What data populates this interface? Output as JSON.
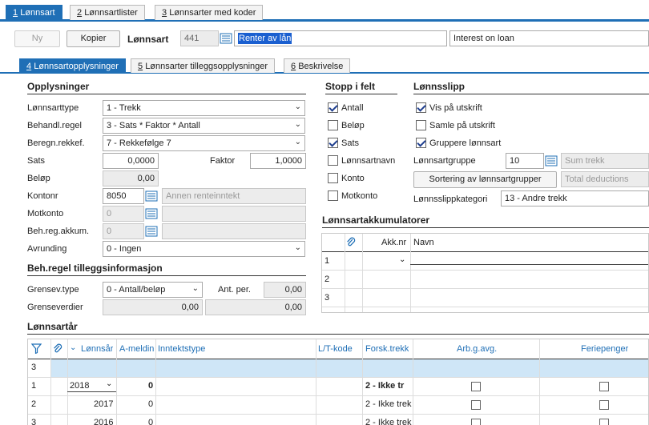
{
  "top_tabs": [
    {
      "key": "1",
      "label": "Lønnsart"
    },
    {
      "key": "2",
      "label": "Lønnsartlister"
    },
    {
      "key": "3",
      "label": "Lønnsarter med koder"
    }
  ],
  "header": {
    "new_button": "Ny",
    "copy_button": "Kopier",
    "lonnsart_label": "Lønnsart",
    "lonnsart_number": "441",
    "name_no": "Renter av lån",
    "name_en": "Interest on loan"
  },
  "sub_tabs": [
    {
      "key": "4",
      "label": "Lønnsartopplysninger"
    },
    {
      "key": "5",
      "label": "Lønnsarter tilleggsopplysninger"
    },
    {
      "key": "6",
      "label": "Beskrivelse"
    }
  ],
  "opplysninger": {
    "title": "Opplysninger",
    "lonnsarttype_label": "Lønnsarttype",
    "lonnsarttype_value": "1 - Trekk",
    "behandl_label": "Behandl.regel",
    "behandl_value": "3 - Sats * Faktor * Antall",
    "beregn_label": "Beregn.rekkef.",
    "beregn_value": "7 - Rekkefølge 7",
    "sats_label": "Sats",
    "sats_value": "0,0000",
    "faktor_label": "Faktor",
    "faktor_value": "1,0000",
    "belop_label": "Beløp",
    "belop_value": "0,00",
    "kontonr_label": "Kontonr",
    "kontonr_value": "8050",
    "kontonr_desc": "Annen renteinntekt",
    "motkonto_label": "Motkonto",
    "motkonto_value": "0",
    "behreg_label": "Beh.reg.akkum.",
    "behreg_value": "0",
    "avrunding_label": "Avrunding",
    "avrunding_value": "0 - Ingen"
  },
  "tillegg": {
    "title": "Beh.regel tilleggsinformasjon",
    "grensev_label": "Grensev.type",
    "grensev_value": "0 - Antall/beløp",
    "antper_label": "Ant. per.",
    "antper_value": "0,00",
    "grenseverdier_label": "Grenseverdier",
    "grenseverdier_1": "0,00",
    "grenseverdier_2": "0,00"
  },
  "stopp": {
    "title": "Stopp i felt",
    "items": [
      {
        "label": "Antall",
        "checked": true
      },
      {
        "label": "Beløp",
        "checked": false
      },
      {
        "label": "Sats",
        "checked": true
      },
      {
        "label": "Lønnsartnavn",
        "checked": false
      },
      {
        "label": "Konto",
        "checked": false
      },
      {
        "label": "Motkonto",
        "checked": false
      }
    ]
  },
  "lonnsslipp": {
    "title": "Lønnsslipp",
    "vis_label": "Vis på utskrift",
    "vis_checked": true,
    "samle_label": "Samle på utskrift",
    "samle_checked": false,
    "grupper_label": "Gruppere lønnsart",
    "grupper_checked": true,
    "gruppe_label": "Lønnsartgruppe",
    "gruppe_value": "10",
    "gruppe_desc": "Sum trekk",
    "sortering_button": "Sortering av lønnsartgrupper",
    "sortering_desc": "Total deductions",
    "kategori_label": "Lønnsslippkategori",
    "kategori_value": "13 - Andre trekk"
  },
  "akkumulatorer": {
    "title": "Lønnsartakkumulatorer",
    "col_akk": "Akk.nr",
    "col_navn": "Navn",
    "rows": [
      "1",
      "2",
      "3"
    ]
  },
  "lonnsartar": {
    "title": "Lønnsartår",
    "columns": [
      "Lønnsår",
      "A-meldin",
      "Inntektstype",
      "L/T-kode",
      "Forsk.trekk",
      "Arb.g.avg.",
      "Feriepenger"
    ],
    "filter_row": "3",
    "rows": [
      {
        "n": "1",
        "year": "2018",
        "ameld": "0",
        "forsk": "2 - Ikke tr"
      },
      {
        "n": "2",
        "year": "2017",
        "ameld": "0",
        "forsk": "2 - Ikke trek"
      },
      {
        "n": "3",
        "year": "2016",
        "ameld": "0",
        "forsk": "2 - Ikke trek"
      }
    ]
  },
  "colors": {
    "accent": "#1f6fb6",
    "selection": "#1a5fd0",
    "filter_row": "#cfe6f7"
  }
}
